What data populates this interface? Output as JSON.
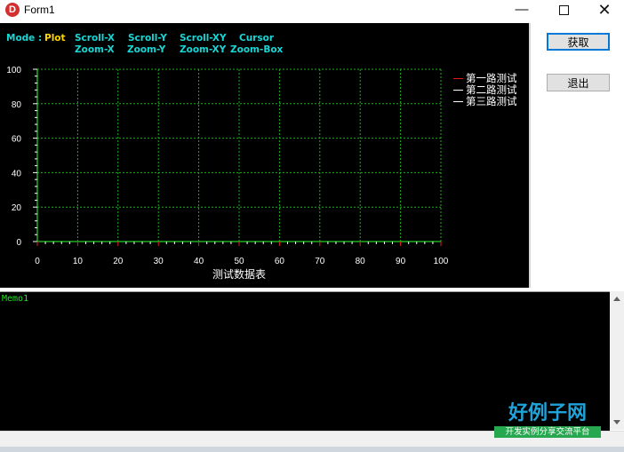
{
  "window": {
    "title": "Form1",
    "icon_letter": "D"
  },
  "chart_toolbar": {
    "mode_label": "Mode :",
    "mode_value": "Plot",
    "actions": [
      [
        "Scroll-X",
        "Zoom-X"
      ],
      [
        "Scroll-Y",
        "Zoom-Y"
      ],
      [
        "Scroll-XY",
        "Zoom-XY"
      ],
      [
        "Cursor",
        "Zoom-Box"
      ]
    ]
  },
  "buttons": {
    "fetch_label": "获取",
    "exit_label": "退出"
  },
  "memo": {
    "text": "Memo1"
  },
  "watermark": {
    "title": "好例子网",
    "subtitle": "开发实例分享交流平台"
  },
  "colors": {
    "chart_background": "#000000",
    "grid": "#1fae1f",
    "axis": "#1fae1f",
    "mode_text": "#17d6d6",
    "mode_value": "#ffd400",
    "memo_text": "#22e322"
  },
  "chart_data": {
    "type": "line",
    "title": "",
    "xlabel": "测试数据表",
    "ylabel": "",
    "xlim": [
      0,
      100
    ],
    "ylim": [
      0,
      100
    ],
    "x_ticks": [
      0,
      10,
      20,
      30,
      40,
      50,
      60,
      70,
      80,
      90,
      100
    ],
    "y_ticks": [
      0,
      20,
      40,
      60,
      80,
      100
    ],
    "grid": true,
    "legend_position": "right",
    "series": [
      {
        "name": "第一路测试",
        "color": "#e01818",
        "values": []
      },
      {
        "name": "第二路测试",
        "color": "#ffffff",
        "values": []
      },
      {
        "name": "第三路测试",
        "color": "#ffffff",
        "values": []
      }
    ]
  }
}
